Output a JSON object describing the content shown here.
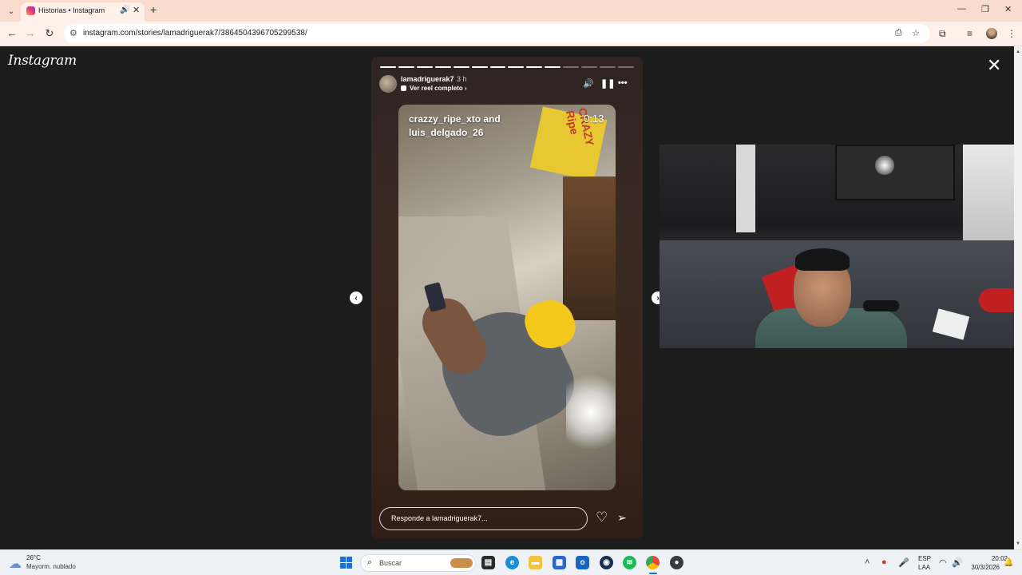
{
  "browser": {
    "tab_title": "Historias • Instagram",
    "url": "instagram.com/stories/lamadriguerak7/3864504396705299538/",
    "tab_menu_icon": "chevron-down-icon",
    "new_tab_symbol": "+",
    "tab_close_symbol": "✕",
    "tab_audio_symbol": "🔊"
  },
  "instagram": {
    "logo_text": "Instagram",
    "close_symbol": "✕"
  },
  "story": {
    "username": "lamadriguerak7",
    "time_ago": "3 h",
    "reel_link": "Ver reel completo",
    "reel_link_chevron": "›",
    "progress_total_segments": 14,
    "progress_completed_segments": 10,
    "media_caption_line1": "crazzy_ripe_xto and",
    "media_caption_line2": "luis_delgado_26",
    "media_duration": "0:13",
    "media_box_text": "CRAZY Ripe",
    "reply_placeholder": "Responde a lamadriguerak7...",
    "prev_symbol": "‹",
    "next_symbol": "›"
  },
  "taskbar": {
    "weather_temp": "26°C",
    "weather_desc": "Mayorm. nublado",
    "search_label": "Buscar",
    "lang_line1": "ESP",
    "lang_line2": "LAA",
    "time": "20:02",
    "date": "30/3/2026",
    "apps": [
      "file-manager-icon",
      "edge-icon",
      "files-icon",
      "store-icon",
      "outlook-icon",
      "steam-icon",
      "spotify-icon",
      "chrome-icon",
      "obs-icon"
    ]
  },
  "colors": {
    "tabbar_bg": "#f9dccd",
    "toolbar_bg": "#fdf1ea",
    "page_bg": "#1c1c1c",
    "taskbar_bg": "#eef1f6",
    "accent": "#1a73d9"
  }
}
